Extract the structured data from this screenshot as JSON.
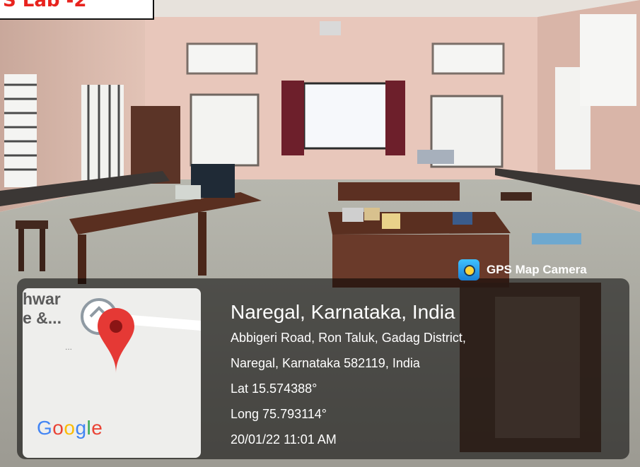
{
  "caption": {
    "text": "S Lab -2",
    "color": "#e8231e"
  },
  "app": {
    "name": "GPS Map Camera",
    "icon": "camera-pin-icon"
  },
  "map": {
    "place_label": "hwar\ne &...",
    "dots": "...",
    "pin_color": "#e53935",
    "logo": {
      "g1": "G",
      "o1": "o",
      "o2": "o",
      "g2": "g",
      "l": "l",
      "e": "e"
    }
  },
  "location": {
    "title": "Naregal, Karnataka, India",
    "address_line1": "Abbigeri Road, Ron Taluk, Gadag District,",
    "address_line2": "Naregal, Karnataka 582119, India",
    "lat": "Lat 15.574388°",
    "long": "Long 75.793114°",
    "datetime": "20/01/22 11:01 AM"
  }
}
